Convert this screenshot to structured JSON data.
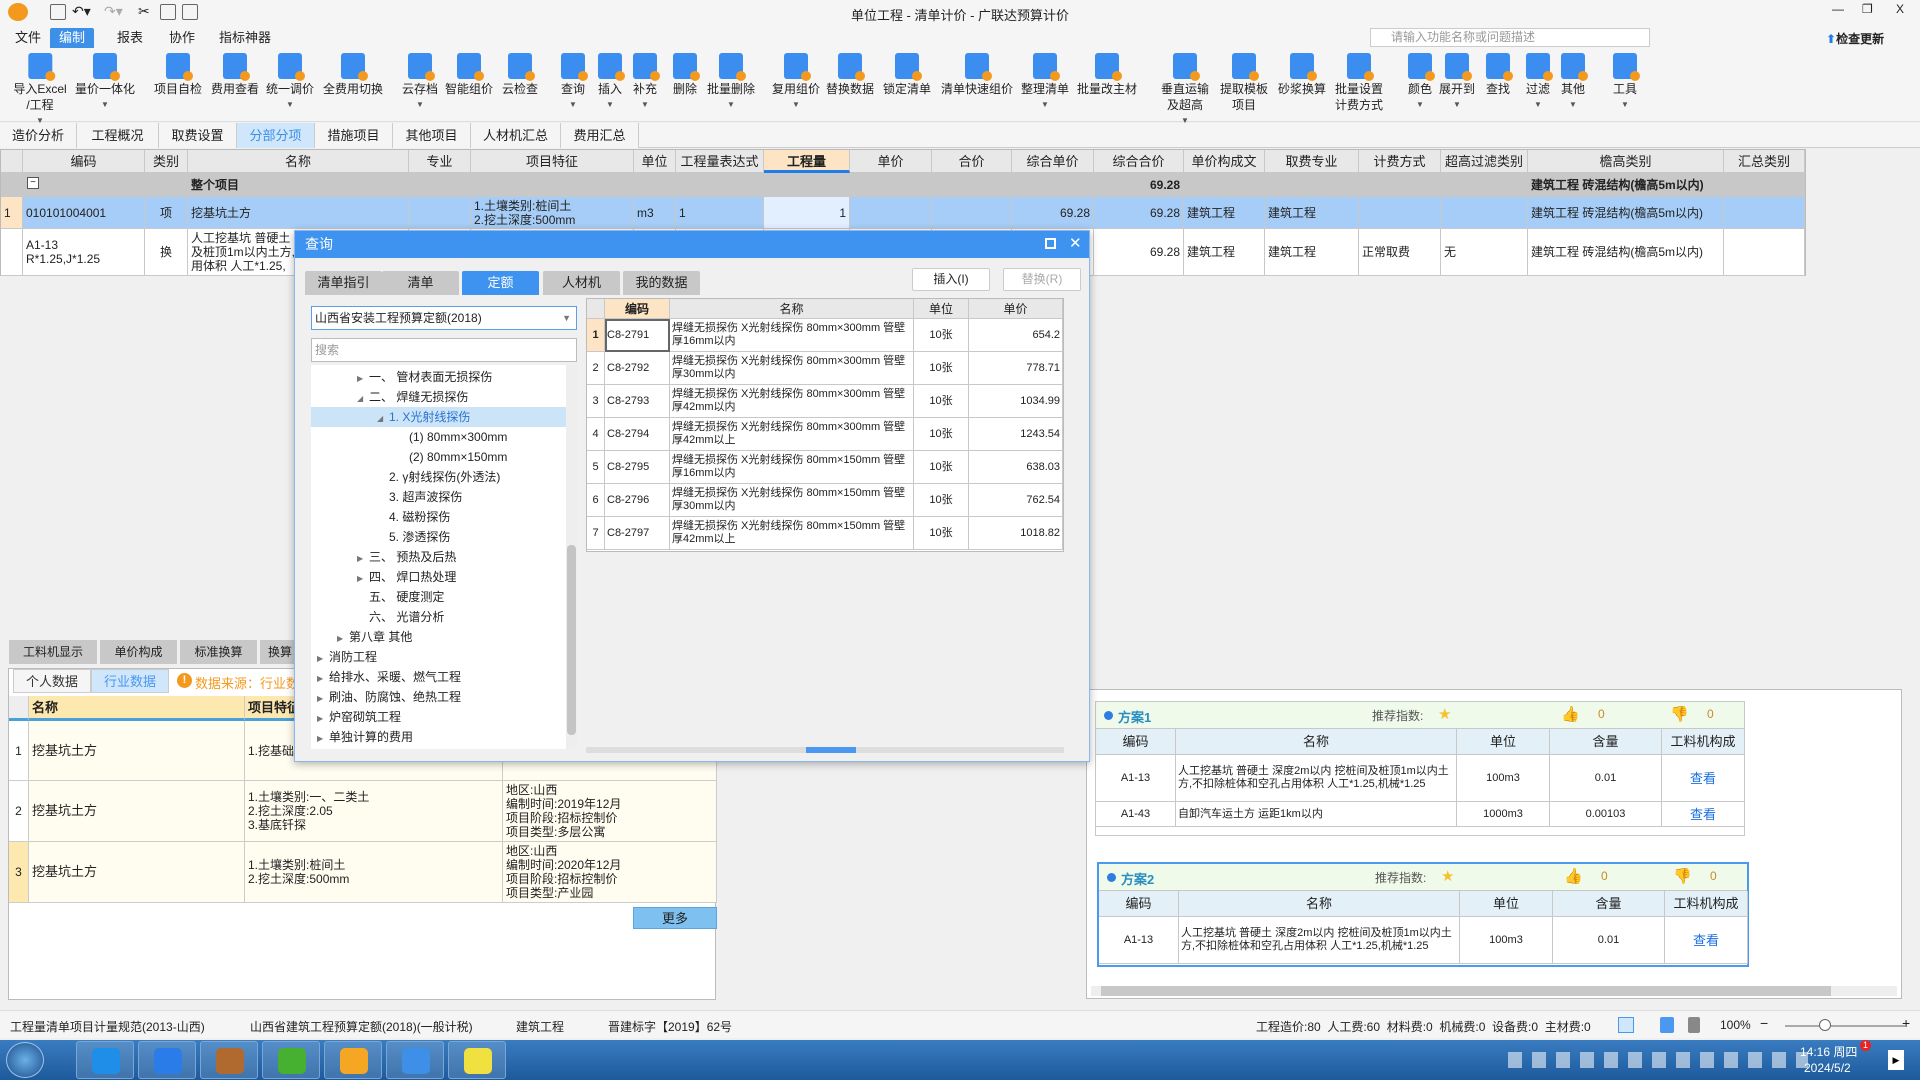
{
  "window": {
    "title": "单位工程 - 清单计价 - 广联达预算计价"
  },
  "menu": [
    "文件",
    "编制",
    "报表",
    "协作",
    "指标神器"
  ],
  "menu_active": 1,
  "search": {
    "placeholder": "请输入功能名称或问题描述"
  },
  "update_label": "检查更新",
  "ribbon": [
    {
      "label": "导入Excel\n/工程",
      "dd": true
    },
    {
      "label": "量价一体化",
      "dd": true
    },
    {
      "label": "项目自检"
    },
    {
      "label": "费用查看"
    },
    {
      "label": "统一调价",
      "dd": true
    },
    {
      "label": "全费用切换"
    },
    {
      "label": "云存档",
      "dd": true
    },
    {
      "label": "智能组价"
    },
    {
      "label": "云检查"
    },
    {
      "label": "查询",
      "dd": true
    },
    {
      "label": "插入",
      "dd": true
    },
    {
      "label": "补充",
      "dd": true
    },
    {
      "label": "删除"
    },
    {
      "label": "批量删除",
      "dd": true
    },
    {
      "label": "复用组价",
      "dd": true
    },
    {
      "label": "替换数据"
    },
    {
      "label": "锁定清单"
    },
    {
      "label": "清单快速组价"
    },
    {
      "label": "整理清单",
      "dd": true
    },
    {
      "label": "批量改主材"
    },
    {
      "label": "垂直运输\n及超高",
      "dd": true
    },
    {
      "label": "提取模板\n项目"
    },
    {
      "label": "砂浆换算"
    },
    {
      "label": "批量设置\n计费方式"
    },
    {
      "label": "颜色",
      "dd": true
    },
    {
      "label": "展开到",
      "dd": true
    },
    {
      "label": "查找"
    },
    {
      "label": "过滤",
      "dd": true
    },
    {
      "label": "其他",
      "dd": true
    },
    {
      "label": "工具",
      "dd": true
    }
  ],
  "tabs": [
    "造价分析",
    "工程概况",
    "取费设置",
    "分部分项",
    "措施项目",
    "其他项目",
    "人材机汇总",
    "费用汇总"
  ],
  "tab_active": 3,
  "grid": {
    "headers": [
      "",
      "编码",
      "类别",
      "名称",
      "专业",
      "项目特征",
      "单位",
      "工程量表达式",
      "工程量",
      "单价",
      "合价",
      "综合单价",
      "综合合价",
      "单价构成文件",
      "取费专业",
      "计费方式",
      "超高过滤类别",
      "檐高类别",
      "汇总类别"
    ],
    "rows": [
      [
        "",
        "",
        "",
        "整个项目",
        "",
        "",
        "",
        "",
        "",
        "",
        "",
        "",
        "69.28",
        "",
        "",
        "",
        "",
        "建筑工程 砖混结构(檐高5m以内)",
        ""
      ],
      [
        "1",
        "010101004001",
        "项",
        "挖基坑土方",
        "",
        "1.土壤类别:桩间土\n2.挖土深度:500mm",
        "m3",
        "1",
        "1",
        "",
        "",
        "69.28",
        "69.28",
        "建筑工程",
        "建筑工程",
        "",
        "",
        "建筑工程 砖混结构(檐高5m以内)",
        ""
      ],
      [
        "",
        "A1-13\nR*1.25,J*1.25",
        "换",
        "人工挖基坑 普硬土 深度2m以内 挖桩间及桩顶1m以内土方,不扣除桩体和空孔占用体积 人工*1.25,",
        "",
        "",
        "",
        "",
        "",
        "",
        "",
        "",
        "69.28",
        "建筑工程",
        "建筑工程",
        "正常取费",
        "无",
        "建筑工程 砖混结构(檐高5m以内)",
        ""
      ]
    ]
  },
  "dialog": {
    "title": "查询",
    "tabs": [
      "清单指引",
      "清单",
      "定额",
      "人材机",
      "我的数据"
    ],
    "tab_active": 2,
    "insert_label": "插入(I)",
    "replace_label": "替换(R)",
    "quota_select": "山西省安装工程预算定额(2018)",
    "search_placeholder": "搜索",
    "tree": [
      {
        "label": "一、 管材表面无损探伤",
        "level": 2,
        "state": "collapsed"
      },
      {
        "label": "二、 焊缝无损探伤",
        "level": 2,
        "state": "expanded"
      },
      {
        "label": "1. X光射线探伤",
        "level": 3,
        "state": "expanded",
        "selected": true
      },
      {
        "label": "(1) 80mm×300mm",
        "level": 4,
        "state": "none"
      },
      {
        "label": "(2) 80mm×150mm",
        "level": 4,
        "state": "none"
      },
      {
        "label": "2. γ射线探伤(外透法)",
        "level": 3,
        "state": "none"
      },
      {
        "label": "3. 超声波探伤",
        "level": 3,
        "state": "none"
      },
      {
        "label": "4. 磁粉探伤",
        "level": 3,
        "state": "none"
      },
      {
        "label": "5. 渗透探伤",
        "level": 3,
        "state": "none"
      },
      {
        "label": "三、 预热及后热",
        "level": 2,
        "state": "collapsed"
      },
      {
        "label": "四、 焊口热处理",
        "level": 2,
        "state": "collapsed"
      },
      {
        "label": "五、 硬度测定",
        "level": 2,
        "state": "none"
      },
      {
        "label": "六、 光谱分析",
        "level": 2,
        "state": "none"
      },
      {
        "label": "第八章 其他",
        "level": 1,
        "state": "collapsed"
      },
      {
        "label": "消防工程",
        "level": 0,
        "state": "collapsed"
      },
      {
        "label": "给排水、采暖、燃气工程",
        "level": 0,
        "state": "collapsed"
      },
      {
        "label": "刷油、防腐蚀、绝热工程",
        "level": 0,
        "state": "collapsed"
      },
      {
        "label": "炉窑砌筑工程",
        "level": 0,
        "state": "collapsed"
      },
      {
        "label": "单独计算的费用",
        "level": 0,
        "state": "collapsed"
      }
    ],
    "table": {
      "headers": [
        "",
        "编码",
        "名称",
        "单位",
        "单价"
      ],
      "rows": [
        [
          "1",
          "C8-2791",
          "焊缝无损探伤 X光射线探伤 80mm×300mm 管壁厚16mm以内",
          "10张",
          "654.2"
        ],
        [
          "2",
          "C8-2792",
          "焊缝无损探伤 X光射线探伤 80mm×300mm 管壁厚30mm以内",
          "10张",
          "778.71"
        ],
        [
          "3",
          "C8-2793",
          "焊缝无损探伤 X光射线探伤 80mm×300mm 管壁厚42mm以内",
          "10张",
          "1034.99"
        ],
        [
          "4",
          "C8-2794",
          "焊缝无损探伤 X光射线探伤 80mm×300mm 管壁厚42mm以上",
          "10张",
          "1243.54"
        ],
        [
          "5",
          "C8-2795",
          "焊缝无损探伤 X光射线探伤 80mm×150mm 管壁厚16mm以内",
          "10张",
          "638.03"
        ],
        [
          "6",
          "C8-2796",
          "焊缝无损探伤 X光射线探伤 80mm×150mm 管壁厚30mm以内",
          "10张",
          "762.54"
        ],
        [
          "7",
          "C8-2797",
          "焊缝无损探伤 X光射线探伤 80mm×150mm 管壁厚42mm以上",
          "10张",
          "1018.82"
        ]
      ]
    }
  },
  "lower": {
    "tabs": [
      "工料机显示",
      "单价构成",
      "标准换算",
      "换算"
    ],
    "subtabs": [
      "个人数据",
      "行业数据"
    ],
    "subtab_active": 1,
    "source_text": "数据来源：行业数据",
    "headers": [
      "",
      "名称",
      "项目特征",
      ""
    ],
    "rows": [
      [
        "1",
        "挖基坑土方",
        "1.挖基础",
        "项目类型:多层保障房"
      ],
      [
        "2",
        "挖基坑土方",
        "1.土壤类别:一、二类土\n2.挖土深度:2.05\n3.基底钎探",
        "地区:山西\n编制时间:2019年12月\n项目阶段:招标控制价\n项目类型:多层公寓"
      ],
      [
        "3",
        "挖基坑土方",
        "1.土壤类别:桩间土\n2.挖土深度:500mm",
        "地区:山西\n编制时间:2020年12月\n项目阶段:招标控制价\n项目类型:产业园"
      ]
    ],
    "more_label": "更多"
  },
  "plans": [
    {
      "title": "方案1",
      "rec_label": "推荐指数:",
      "likes": "0",
      "dislikes": "0",
      "headers": [
        "编码",
        "名称",
        "单位",
        "含量",
        "工料机构成"
      ],
      "rows": [
        [
          "A1-13",
          "人工挖基坑 普硬土 深度2m以内  挖桩间及桩顶1m以内土方,不扣除桩体和空孔占用体积 人工*1.25,机械*1.25",
          "100m3",
          "0.01",
          "查看"
        ],
        [
          "A1-43",
          "自卸汽车运土方 运距1km以内",
          "1000m3",
          "0.00103",
          "查看"
        ]
      ]
    },
    {
      "title": "方案2",
      "rec_label": "推荐指数:",
      "likes": "0",
      "dislikes": "0",
      "headers": [
        "编码",
        "名称",
        "单位",
        "含量",
        "工料机构成"
      ],
      "rows": [
        [
          "A1-13",
          "人工挖基坑 普硬土 深度2m以内  挖桩间及桩顶1m以内土方,不扣除桩体和空孔占用体积 人工*1.25,机械*1.25",
          "100m3",
          "0.01",
          "查看"
        ]
      ]
    }
  ],
  "status": {
    "left": [
      "工程量清单项目计量规范(2013-山西)",
      "山西省建筑工程预算定额(2018)(一般计税)",
      "建筑工程",
      "晋建标字【2019】62号"
    ],
    "costs": "工程造价:80  人工费:60  材料费:0  机械费:0  设备费:0  主材费:0",
    "zoom": "100%"
  },
  "taskbar": {
    "time": "14:16 周四",
    "date": "2024/5/2",
    "badge": "1"
  },
  "colors": {
    "accent": "#3d93ef",
    "selected_row": "#a6cdf7",
    "highlight": "#fde4c4"
  }
}
